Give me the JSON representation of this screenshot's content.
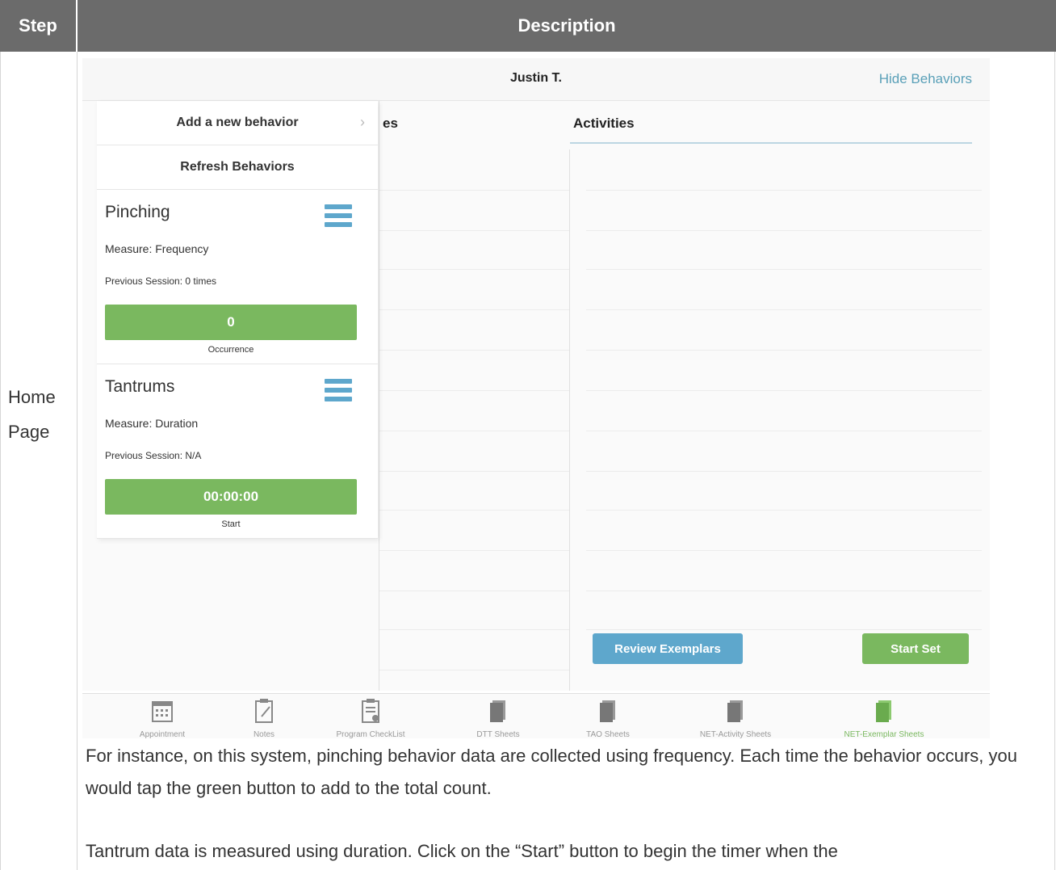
{
  "table": {
    "header_step": "Step",
    "header_description": "Description",
    "row_step": "Home Page"
  },
  "screenshot": {
    "header_title": "Justin T.",
    "hide_behaviors": "Hide Behaviors",
    "col_partial": "es",
    "col_activities": "Activities",
    "add_behavior": "Add a new behavior",
    "refresh_behaviors": "Refresh Behaviors",
    "behaviors": [
      {
        "name": "Pinching",
        "measure": "Measure: Frequency",
        "previous": "Previous Session: 0 times",
        "button": "0",
        "caption": "Occurrence"
      },
      {
        "name": "Tantrums",
        "measure": "Measure: Duration",
        "previous": "Previous Session: N/A",
        "button": "00:00:00",
        "caption": "Start"
      }
    ],
    "review_exemplars": "Review Exemplars",
    "start_set": "Start Set",
    "tabs": [
      {
        "label": "Appointment",
        "icon": "calendar-icon"
      },
      {
        "label": "Notes",
        "icon": "notes-icon"
      },
      {
        "label": "Program CheckList",
        "icon": "checklist-icon"
      },
      {
        "label": "DTT Sheets",
        "icon": "sheets-icon"
      },
      {
        "label": "TAO Sheets",
        "icon": "sheets-icon"
      },
      {
        "label": "NET-Activity Sheets",
        "icon": "sheets-icon"
      },
      {
        "label": "NET-Exemplar Sheets",
        "icon": "sheets-icon",
        "active": true
      }
    ],
    "colors": {
      "green": "#7ab85f",
      "blue": "#5ea7cc",
      "header": "#6b6b6b"
    }
  },
  "paragraphs": {
    "p1": "For instance, on this system, pinching behavior data are collected using frequency. Each time the behavior occurs, you would tap the green button to add to the total count.",
    "p2": "Tantrum data is measured using duration. Click on the “Start” button to begin the timer when the"
  }
}
